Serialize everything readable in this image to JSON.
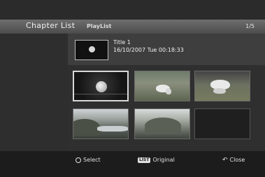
{
  "header": {
    "title": "Chapter List",
    "subtitle": "PlayList",
    "page_indicator": "1/5"
  },
  "info": {
    "title": "Title 1",
    "date_line": "16/10/2007  Tue  00:18:33"
  },
  "thumbnails": [
    {
      "name": "thumbnail-moon",
      "selected": true
    },
    {
      "name": "thumbnail-horse-grazing",
      "selected": false
    },
    {
      "name": "thumbnail-white-horse",
      "selected": false
    },
    {
      "name": "thumbnail-river-landscape",
      "selected": false
    },
    {
      "name": "thumbnail-rock-landscape",
      "selected": false
    },
    {
      "name": "thumbnail-empty",
      "selected": false
    }
  ],
  "footer": {
    "select_label": "Select",
    "original_icon_text": "LIST",
    "original_label": "Original",
    "close_label": "Close",
    "select_icon": "circle-icon",
    "original_icon": "list-button-icon",
    "close_icon": "return-icon"
  },
  "colors": {
    "header_bg": "#5c5c5c",
    "panel_bg": "#3e3e3e",
    "footer_bg": "#1c1c1c",
    "highlight_border": "#d9d9d9"
  }
}
